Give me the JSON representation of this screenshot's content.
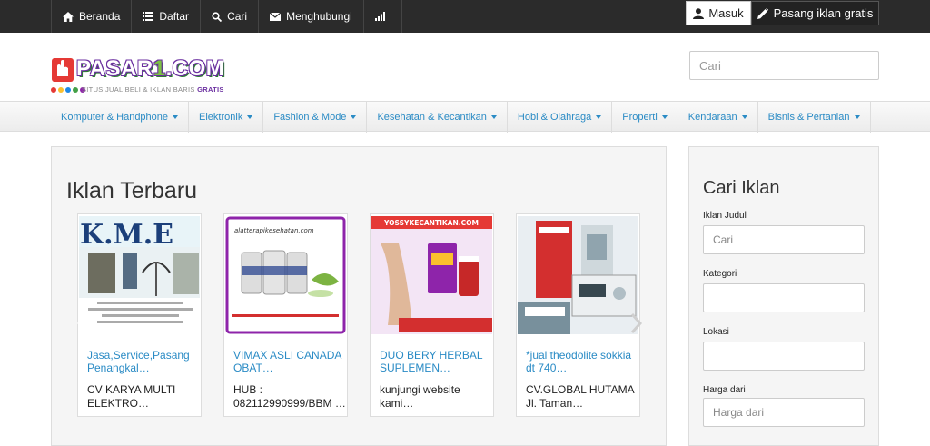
{
  "topnav": {
    "items": [
      {
        "label": "Beranda",
        "icon": "home-icon"
      },
      {
        "label": "Daftar",
        "icon": "list-icon"
      },
      {
        "label": "Cari",
        "icon": "search-icon"
      },
      {
        "label": "Menghubungi",
        "icon": "envelope-icon"
      },
      {
        "label": "",
        "icon": "signal-icon"
      }
    ],
    "login_label": "Masuk",
    "post_ad_label": "Pasang iklan gratis"
  },
  "header": {
    "logo_text_a": "PASAR",
    "logo_text_b": "1",
    "logo_text_c": ".COM",
    "tagline_a": "SITUS JUAL BELI & IKLAN BARIS ",
    "tagline_b": "GRATIS",
    "search_placeholder": "Cari"
  },
  "categories": [
    "Komputer & Handphone",
    "Elektronik",
    "Fashion & Mode",
    "Kesehatan & Kecantikan",
    "Hobi & Olahraga",
    "Properti",
    "Kendaraan",
    "Bisnis & Pertanian"
  ],
  "main": {
    "heading": "Iklan Terbaru",
    "listings": [
      {
        "title": "Jasa,Service,Pasang Penangkal…",
        "desc": "CV KARYA MULTI ELEKTRO…",
        "thumb_text": "K.M.E"
      },
      {
        "title": "VIMAX ASLI CANADA OBAT…",
        "desc": "HUB : 082112990999/BBM …",
        "thumb_text": "alatterapikesehatan.com"
      },
      {
        "title": "DUO BERY HERBAL SUPLEMEN…",
        "desc": "kunjungi website kami…",
        "thumb_text": "YOSSYKECANTIKAN.COM"
      },
      {
        "title": "*jual theodolite sokkia dt 740…",
        "desc": "CV.GLOBAL HUTAMA Jl. Taman…",
        "thumb_text": ""
      }
    ]
  },
  "sidebar": {
    "heading": "Cari Iklan",
    "fields": [
      {
        "label": "Iklan Judul",
        "placeholder": "Cari"
      },
      {
        "label": "Kategori",
        "placeholder": ""
      },
      {
        "label": "Lokasi",
        "placeholder": ""
      },
      {
        "label": "Harga dari",
        "placeholder": "Harga dari"
      }
    ]
  },
  "colors": {
    "topbar": "#2b2b2b",
    "link": "#2a8bc5",
    "logo_purple": "#6b2fa0",
    "logo_green": "#7cc242"
  }
}
